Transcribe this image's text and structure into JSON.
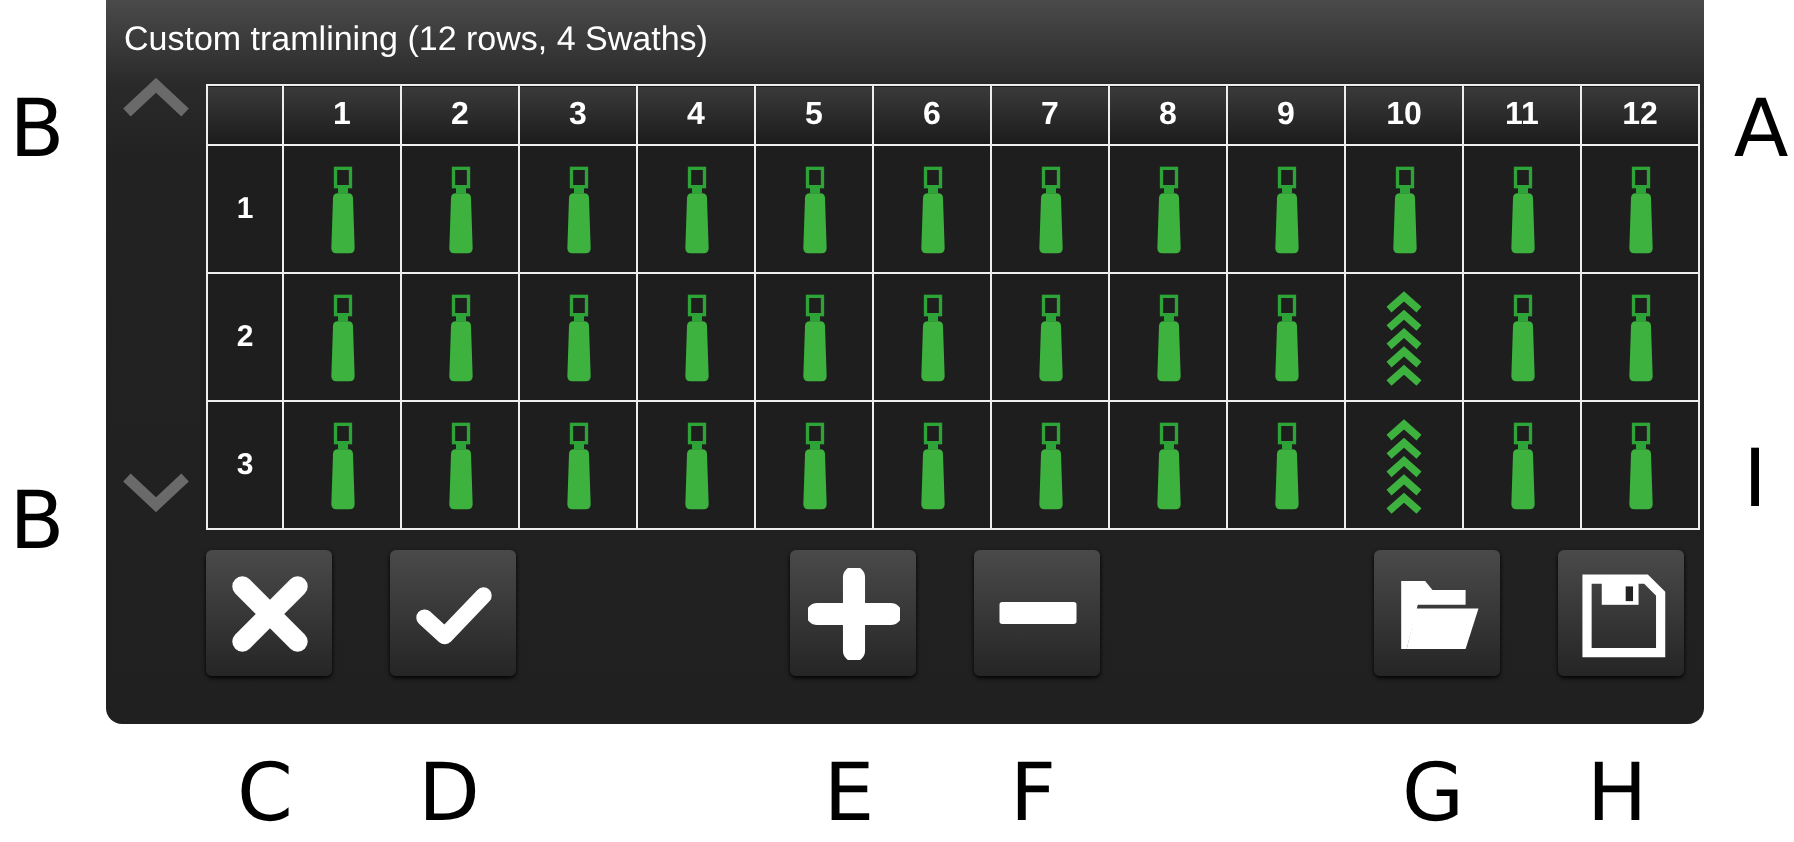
{
  "dialog": {
    "title": "Custom tramlining (12 rows, 4 Swaths)"
  },
  "scroll": [
    {
      "kind": "up"
    },
    {
      "kind": "down"
    }
  ],
  "columns": [
    "1",
    "2",
    "3",
    "4",
    "5",
    "6",
    "7",
    "8",
    "9",
    "10",
    "11",
    "12"
  ],
  "rows": [
    {
      "label": "1",
      "cells": [
        {
          "kind": "nozzle"
        },
        {
          "kind": "nozzle"
        },
        {
          "kind": "nozzle"
        },
        {
          "kind": "nozzle"
        },
        {
          "kind": "nozzle"
        },
        {
          "kind": "nozzle"
        },
        {
          "kind": "nozzle"
        },
        {
          "kind": "nozzle"
        },
        {
          "kind": "nozzle"
        },
        {
          "kind": "nozzle"
        },
        {
          "kind": "nozzle"
        },
        {
          "kind": "nozzle"
        }
      ]
    },
    {
      "label": "2",
      "cells": [
        {
          "kind": "nozzle"
        },
        {
          "kind": "nozzle"
        },
        {
          "kind": "nozzle"
        },
        {
          "kind": "nozzle"
        },
        {
          "kind": "nozzle"
        },
        {
          "kind": "nozzle"
        },
        {
          "kind": "nozzle"
        },
        {
          "kind": "nozzle"
        },
        {
          "kind": "nozzle"
        },
        {
          "kind": "tramline"
        },
        {
          "kind": "nozzle"
        },
        {
          "kind": "nozzle"
        }
      ]
    },
    {
      "label": "3",
      "cells": [
        {
          "kind": "nozzle"
        },
        {
          "kind": "nozzle"
        },
        {
          "kind": "nozzle"
        },
        {
          "kind": "nozzle"
        },
        {
          "kind": "nozzle"
        },
        {
          "kind": "nozzle"
        },
        {
          "kind": "nozzle"
        },
        {
          "kind": "nozzle"
        },
        {
          "kind": "nozzle"
        },
        {
          "kind": "tramline"
        },
        {
          "kind": "nozzle"
        },
        {
          "kind": "nozzle"
        }
      ]
    }
  ],
  "buttons": [
    {
      "kind": "cancel"
    },
    {
      "kind": "confirm"
    },
    {
      "kind": "add"
    },
    {
      "kind": "remove"
    },
    {
      "kind": "open"
    },
    {
      "kind": "save"
    }
  ],
  "annotations": {
    "left": [
      "B",
      "B"
    ],
    "right": [
      "A",
      "I"
    ],
    "bottom": [
      "C",
      "D",
      "E",
      "F",
      "G",
      "H"
    ]
  }
}
